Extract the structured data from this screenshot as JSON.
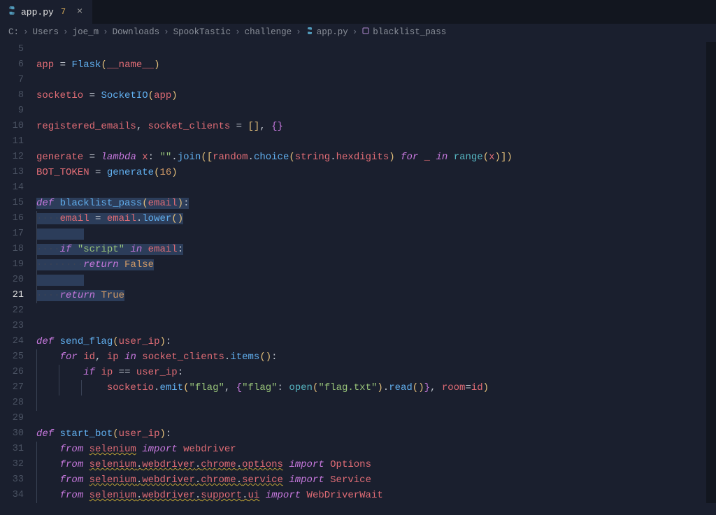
{
  "tab": {
    "filename": "app.py",
    "modified_badge": "7",
    "close_glyph": "×",
    "python_glyph": "⚙"
  },
  "breadcrumb": {
    "sep": "›",
    "items": [
      "C:",
      "Users",
      "joe_m",
      "Downloads",
      "SpookTastic",
      "challenge"
    ],
    "file": "app.py",
    "symbol": "blacklist_pass",
    "python_glyph": "⚙",
    "symbol_glyph": "⬡"
  },
  "gutter": {
    "start": 5,
    "end": 34,
    "active": 21
  },
  "code": {
    "truncated_top": "",
    "lines": {
      "6": "app = Flask(__name__)",
      "8": "socketio = SocketIO(app)",
      "10": "registered_emails, socket_clients = [], {}",
      "12": "generate = lambda x: \"\".join([random.choice(string.hexdigits) for _ in range(x)])",
      "13": "BOT_TOKEN = generate(16)",
      "15": "def blacklist_pass(email):",
      "16": "    email = email.lower()",
      "18": "    if \"script\" in email:",
      "19": "        return False",
      "21": "    return True",
      "24": "def send_flag(user_ip):",
      "25": "    for id, ip in socket_clients.items():",
      "26": "        if ip == user_ip:",
      "27": "            socketio.emit(\"flag\", {\"flag\": open(\"flag.txt\").read()}, room=id)",
      "30": "def start_bot(user_ip):",
      "31": "    from selenium import webdriver",
      "32": "    from selenium.webdriver.chrome.options import Options",
      "33": "    from selenium.webdriver.chrome.service import Service",
      "34": "    from selenium.webdriver.support.ui import WebDriverWait"
    }
  }
}
